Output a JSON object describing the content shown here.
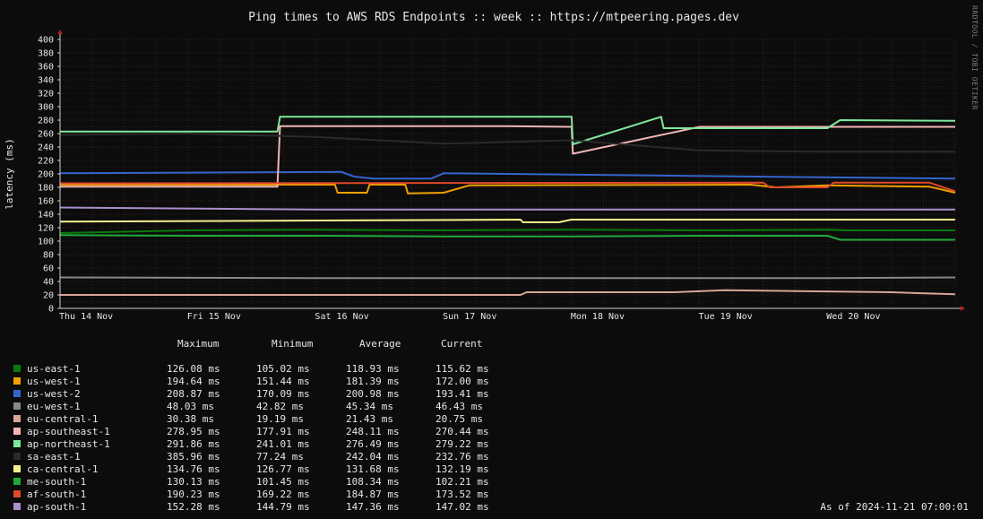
{
  "chart_data": {
    "type": "line",
    "title": "Ping times to AWS RDS Endpoints :: week :: https://mtpeering.pages.dev",
    "ylabel": "latency (ms)",
    "ylim": [
      0,
      400
    ],
    "y_ticks": [
      0,
      20,
      40,
      60,
      80,
      100,
      120,
      140,
      160,
      180,
      200,
      220,
      240,
      260,
      280,
      300,
      320,
      340,
      360,
      380,
      400
    ],
    "x_ticks": [
      "Thu 14 Nov",
      "Fri 15 Nov",
      "Sat 16 Nov",
      "Sun 17 Nov",
      "Mon 18 Nov",
      "Tue 19 Nov",
      "Wed 20 Nov"
    ],
    "x_range_days": [
      0,
      7
    ],
    "grid": true,
    "side_text": "RRDTOOL / TOBI OETIKER",
    "legend_headers": [
      "Maximum",
      "Minimum",
      "Average",
      "Current"
    ],
    "series": [
      {
        "name": "us-east-1",
        "color": "#0b7a0b",
        "max": "126.08 ms",
        "min": "105.02 ms",
        "avg": "118.93 ms",
        "cur": "115.62 ms",
        "x": [
          0,
          1,
          2,
          3,
          4,
          5,
          6,
          6.15,
          7
        ],
        "y": [
          112,
          116,
          117,
          116,
          117,
          116,
          117,
          116,
          116
        ]
      },
      {
        "name": "us-west-1",
        "color": "#f0a000",
        "max": "194.64 ms",
        "min": "151.44 ms",
        "avg": "181.39 ms",
        "cur": "172.00 ms",
        "x": [
          0,
          2.15,
          2.17,
          2.4,
          2.42,
          2.7,
          2.72,
          3,
          3.2,
          5.4,
          5.6,
          6,
          6.8,
          7
        ],
        "y": [
          184,
          184,
          172,
          172,
          184,
          184,
          171,
          172,
          183,
          184,
          180,
          183,
          181,
          172
        ]
      },
      {
        "name": "us-west-2",
        "color": "#3366cc",
        "max": "208.87 ms",
        "min": "170.09 ms",
        "avg": "200.98 ms",
        "cur": "193.41 ms",
        "x": [
          0,
          2.2,
          2.3,
          2.45,
          2.9,
          3,
          7
        ],
        "y": [
          201,
          203,
          196,
          193,
          193,
          201,
          193
        ]
      },
      {
        "name": "eu-west-1",
        "color": "#888888",
        "max": "48.03 ms",
        "min": "42.82 ms",
        "avg": "45.34 ms",
        "cur": "46.43 ms",
        "x": [
          0,
          2,
          4,
          6,
          7
        ],
        "y": [
          46,
          45,
          45,
          45,
          46
        ]
      },
      {
        "name": "eu-central-1",
        "color": "#d8a596",
        "max": "30.38 ms",
        "min": "19.19 ms",
        "avg": "21.43 ms",
        "cur": "20.75 ms",
        "x": [
          0,
          3.6,
          3.65,
          4.8,
          5.2,
          6.5,
          7
        ],
        "y": [
          20,
          20,
          24,
          24,
          27,
          24,
          21
        ]
      },
      {
        "name": "ap-southeast-1",
        "color": "#f4b6b6",
        "max": "278.95 ms",
        "min": "177.91 ms",
        "avg": "248.11 ms",
        "cur": "270.44 ms",
        "x": [
          0,
          1.7,
          1.72,
          3.5,
          4,
          4.01,
          5,
          7
        ],
        "y": [
          181,
          181,
          271,
          271,
          270,
          230,
          270,
          270
        ]
      },
      {
        "name": "ap-northeast-1",
        "color": "#7ee89a",
        "max": "291.86 ms",
        "min": "241.01 ms",
        "avg": "276.49 ms",
        "cur": "279.22 ms",
        "x": [
          0,
          1.7,
          1.72,
          4,
          4.01,
          4.7,
          4.72,
          6,
          6.1,
          7
        ],
        "y": [
          263,
          263,
          285,
          285,
          244,
          285,
          268,
          268,
          280,
          279
        ]
      },
      {
        "name": "sa-east-1",
        "color": "#2a2a2a",
        "max": "385.96 ms",
        "min": "77.24 ms",
        "avg": "242.04 ms",
        "cur": "232.76 ms",
        "x": [
          0,
          1,
          2,
          3,
          4,
          5,
          6,
          7
        ],
        "y": [
          258,
          260,
          255,
          245,
          250,
          235,
          233,
          233
        ]
      },
      {
        "name": "ca-central-1",
        "color": "#f6f08c",
        "max": "134.76 ms",
        "min": "126.77 ms",
        "avg": "131.68 ms",
        "cur": "132.19 ms",
        "x": [
          0,
          3.6,
          3.62,
          3.9,
          4,
          7
        ],
        "y": [
          129,
          132,
          128,
          128,
          132,
          132
        ]
      },
      {
        "name": "me-south-1",
        "color": "#1faa3a",
        "max": "130.13 ms",
        "min": "101.45 ms",
        "avg": "108.34 ms",
        "cur": "102.21 ms",
        "x": [
          0,
          1,
          2,
          3,
          4,
          5,
          6,
          6.1,
          7
        ],
        "y": [
          109,
          108,
          108,
          107,
          107,
          108,
          108,
          102,
          102
        ]
      },
      {
        "name": "af-south-1",
        "color": "#e0482a",
        "max": "190.23 ms",
        "min": "169.22 ms",
        "avg": "184.87 ms",
        "cur": "173.52 ms",
        "x": [
          0,
          5.5,
          5.55,
          6,
          6.05,
          6.8,
          7
        ],
        "y": [
          186,
          187,
          180,
          180,
          187,
          187,
          174
        ]
      },
      {
        "name": "ap-south-1",
        "color": "#a98fcb",
        "max": "152.28 ms",
        "min": "144.79 ms",
        "avg": "147.36 ms",
        "cur": "147.02 ms",
        "x": [
          0,
          2,
          4,
          6,
          7
        ],
        "y": [
          150,
          147,
          147,
          147,
          147
        ]
      }
    ]
  },
  "as_of": "As of 2024-11-21 07:00:01"
}
